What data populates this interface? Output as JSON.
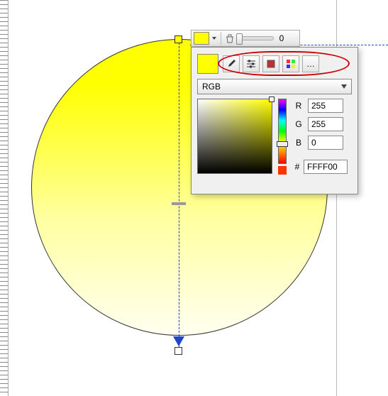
{
  "stop_toolbar": {
    "swatch_color": "#ffff00",
    "offset_value": "0"
  },
  "panel": {
    "current_color": "#ffff00",
    "tools": {
      "eyedropper": "eyedropper-icon",
      "sliders": "sliders-icon",
      "swatches": "swatch-grid-icon",
      "palette": "palette-grid-icon",
      "more": "…"
    },
    "color_model": "RGB",
    "hue_preview": "#ff3300",
    "rgb": {
      "r_label": "R",
      "g_label": "G",
      "b_label": "B",
      "r": "255",
      "g": "255",
      "b": "0"
    },
    "hex_prefix": "#",
    "hex": "FFFF00"
  }
}
